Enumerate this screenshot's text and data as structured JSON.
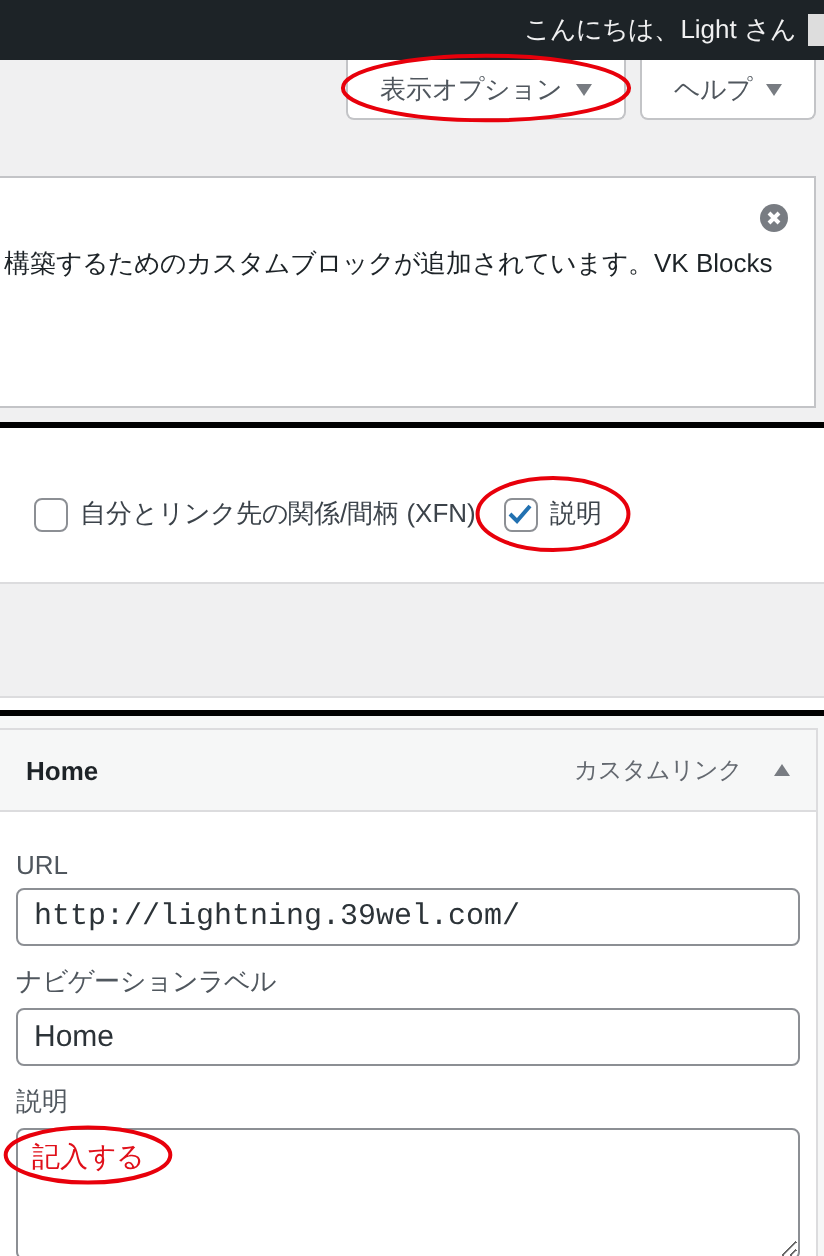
{
  "admin_bar": {
    "greeting": "こんにちは、Light さん"
  },
  "screen_buttons": [
    {
      "label": "表示オプション",
      "circled": true
    },
    {
      "label": "ヘルプ",
      "circled": false
    }
  ],
  "notice": {
    "text": "構築するためのカスタムブロックが追加されています。VK Blocks"
  },
  "screen_options": [
    {
      "label": "自分とリンク先の関係/間柄 (XFN)",
      "checked": false,
      "circled": false
    },
    {
      "label": "説明",
      "checked": true,
      "circled": true
    }
  ],
  "menu_item": {
    "title": "Home",
    "type": "カスタムリンク",
    "expanded": true,
    "fields": [
      {
        "kind": "url",
        "label": "URL",
        "value": "http://lightning.39wel.com/",
        "circled": false
      },
      {
        "kind": "text",
        "label": "ナビゲーションラベル",
        "value": "Home",
        "circled": false
      },
      {
        "kind": "textarea",
        "label": "説明",
        "value": "記入する",
        "circled": true
      }
    ]
  }
}
